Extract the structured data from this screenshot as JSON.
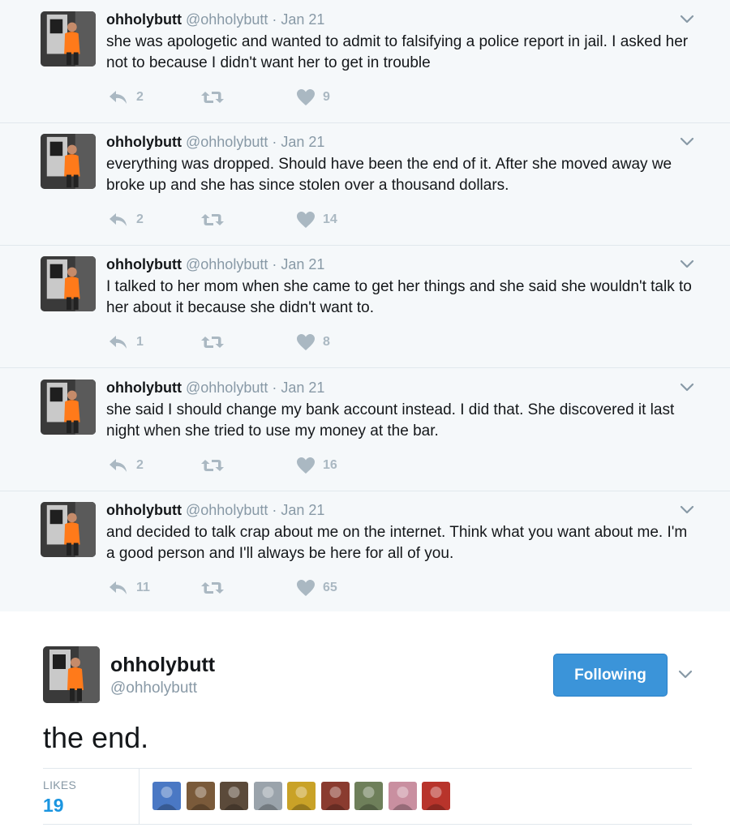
{
  "thread": [
    {
      "name": "ohholybutt",
      "handle": "@ohholybutt",
      "date": "Jan 21",
      "text": "she was apologetic and wanted to admit to falsifying a police report in jail. I asked her not to because I didn't want her to get in trouble",
      "replies": "2",
      "retweets": "",
      "likes": "9"
    },
    {
      "name": "ohholybutt",
      "handle": "@ohholybutt",
      "date": "Jan 21",
      "text": "everything was dropped. Should have been the end of it. After she moved away we broke up and she has since stolen over a thousand dollars.",
      "replies": "2",
      "retweets": "",
      "likes": "14"
    },
    {
      "name": "ohholybutt",
      "handle": "@ohholybutt",
      "date": "Jan 21",
      "text": "I talked to her mom when she came to get her things and she said she wouldn't talk to her about it because she didn't want to.",
      "replies": "1",
      "retweets": "",
      "likes": "8"
    },
    {
      "name": "ohholybutt",
      "handle": "@ohholybutt",
      "date": "Jan 21",
      "text": "she said I should change my bank account instead. I did that. She discovered it last night when she tried to use my money at the bar.",
      "replies": "2",
      "retweets": "",
      "likes": "16"
    },
    {
      "name": "ohholybutt",
      "handle": "@ohholybutt",
      "date": "Jan 21",
      "text": "and decided to talk crap about me on the internet. Think what you want about me. I'm a good person and I'll always be here for all of you.",
      "replies": "11",
      "retweets": "",
      "likes": "65"
    }
  ],
  "main_tweet": {
    "name": "ohholybutt",
    "handle": "@ohholybutt",
    "follow_label": "Following",
    "text": "the end.",
    "likes_label": "LIKES",
    "likes_count": "19",
    "liker_colors": [
      "#4a78c4",
      "#7a5a3a",
      "#5b4a3a",
      "#9aa3ab",
      "#c9a227",
      "#8a3b2f",
      "#6e7f5a",
      "#c98fa0",
      "#b8342b"
    ]
  },
  "icons": {
    "reply": "reply-arrow-icon",
    "retweet": "retweet-icon",
    "like": "heart-icon",
    "caret": "chevron-down-icon"
  },
  "colors": {
    "thread_bg": "#f5f8fa",
    "muted": "#8899a6",
    "action_gray": "#aab8c2",
    "follow_button": "#3b94d9",
    "likes_count": "#1b95e0"
  }
}
